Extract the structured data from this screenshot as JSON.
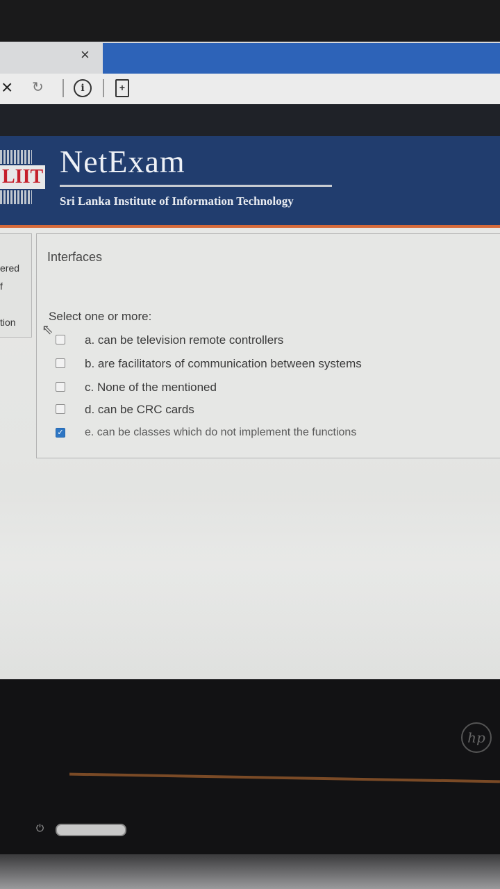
{
  "browser": {
    "tab_close_glyph": "×",
    "toolbar": {
      "stop_glyph": "×",
      "reload_glyph": "↻",
      "info_glyph": "i",
      "page_glyph": "+"
    }
  },
  "site": {
    "logo_text": "LIIT",
    "brand_name": "NetExam",
    "institute": "Sri Lanka Institute of Information Technology"
  },
  "sidebar": {
    "fragments": [
      "ered",
      "f",
      "tion"
    ]
  },
  "question": {
    "title": "Interfaces",
    "prompt": "Select one or more:",
    "options": [
      {
        "label": "a. can be television remote controllers",
        "checked": false
      },
      {
        "label": "b. are facilitators of communication between systems",
        "checked": false
      },
      {
        "label": "c. None of the mentioned",
        "checked": false
      },
      {
        "label": "d. can be CRC cards",
        "checked": false
      },
      {
        "label": "e. can be classes which do not implement the functions",
        "checked": true
      }
    ]
  },
  "device": {
    "brand": "hp",
    "power_glyph": "⏻"
  },
  "colors": {
    "header_bg": "#213d6e",
    "accent_line": "#d66a3a",
    "tab_blue": "#2d63b8",
    "checkbox_checked": "#2e76c3"
  }
}
